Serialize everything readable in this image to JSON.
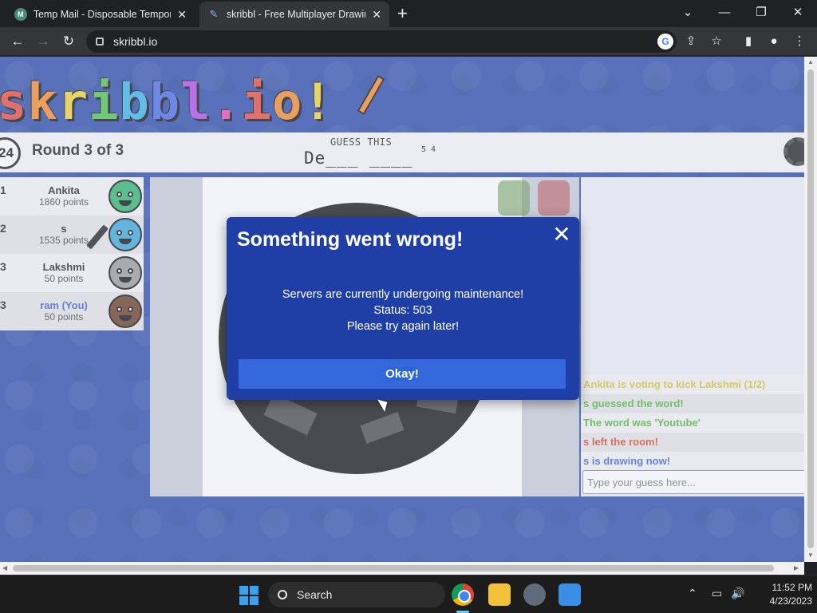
{
  "browser": {
    "tabs": [
      {
        "title": "Temp Mail - Disposable Temporary",
        "favicon": "tempmail-icon"
      },
      {
        "title": "skribbl - Free Multiplayer Drawing",
        "favicon": "skribbl-icon"
      }
    ],
    "url": "skribbl.io"
  },
  "game": {
    "logo": "skribbl.io",
    "timer": "24",
    "round": "Round 3 of 3",
    "guess_label": "GUESS THIS",
    "word_hint": "De___ ____",
    "word_lengths": "5 4",
    "players": [
      {
        "rank": "1",
        "name": "Ankita",
        "points": "1860 points",
        "avatar_color": "#2fb56a"
      },
      {
        "rank": "2",
        "name": "s",
        "points": "1535 points",
        "avatar_color": "#3aa8d8"
      },
      {
        "rank": "3",
        "name": "Lakshmi",
        "points": "50 points",
        "avatar_color": "#9a9a9a"
      },
      {
        "rank": "3",
        "name": "ram (You)",
        "points": "50 points",
        "avatar_color": "#6a3b22"
      }
    ],
    "chat": [
      {
        "text": "Ankita is voting to kick Lakshmi (1/2)",
        "color": "#d8c232"
      },
      {
        "text": "s guessed the word!",
        "color": "#4fb43a"
      },
      {
        "text": "The word was 'Youtube'",
        "color": "#4fb43a"
      },
      {
        "text": "s left the room!",
        "color": "#d84a2a"
      },
      {
        "text": "s is drawing now!",
        "color": "#3a66c8"
      }
    ],
    "guess_placeholder": "Type your guess here..."
  },
  "modal": {
    "title": "Something went wrong!",
    "lines": [
      "Servers are currently undergoing maintenance!",
      "Status: 503",
      "Please try again later!"
    ],
    "button": "Okay!"
  },
  "taskbar": {
    "search": "Search",
    "time": "11:52 PM",
    "date": "4/23/2023"
  },
  "colors": {
    "page_bg": "#2a4aa8",
    "modal_bg": "#1f3fa6",
    "modal_button": "#3568dc"
  }
}
